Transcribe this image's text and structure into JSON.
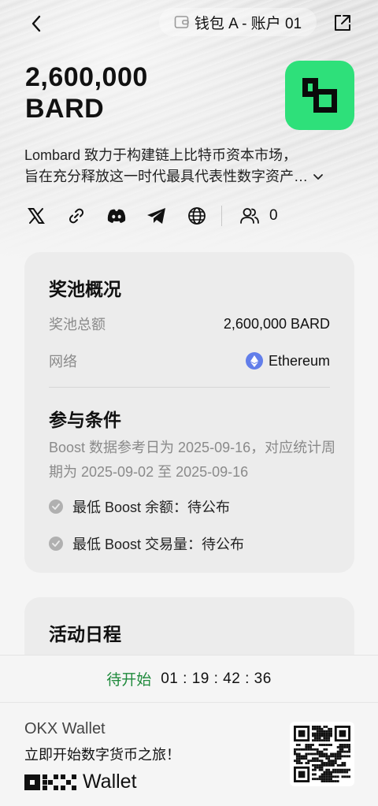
{
  "header": {
    "wallet_label": "钱包 A - 账户 01",
    "icons": [
      "back-arrow-icon",
      "wallet-icon",
      "share-icon"
    ]
  },
  "token": {
    "amount": "2,600,000",
    "symbol": "BARD",
    "logo_color": "#2ee07a",
    "description_line1": "Lombard 致力于构建链上比特币资本市场，",
    "description_line2": "旨在充分释放这一时代最具代表性数字资产…"
  },
  "social": {
    "icons": [
      "x-icon",
      "link-icon",
      "discord-icon",
      "telegram-icon",
      "globe-icon"
    ],
    "followers": "0"
  },
  "pool": {
    "title": "奖池概况",
    "total_label": "奖池总额",
    "total_value": "2,600,000 BARD",
    "network_label": "网络",
    "network_value": "Ethereum"
  },
  "conditions": {
    "title": "参与条件",
    "note": "Boost 数据参考日为 2025-09-16，对应统计周期为 2025-09-02 至 2025-09-16",
    "requirements": [
      "最低 Boost 余额：待公布",
      "最低 Boost 交易量：待公布"
    ]
  },
  "schedule": {
    "title": "活动日程"
  },
  "countdown": {
    "status": "待开始",
    "time": "01 : 19 : 42 : 36",
    "status_color": "#1f8a3c"
  },
  "footer": {
    "title": "OKX Wallet",
    "slogan": "立即开始数字货币之旅！",
    "brand_text": "Wallet"
  }
}
